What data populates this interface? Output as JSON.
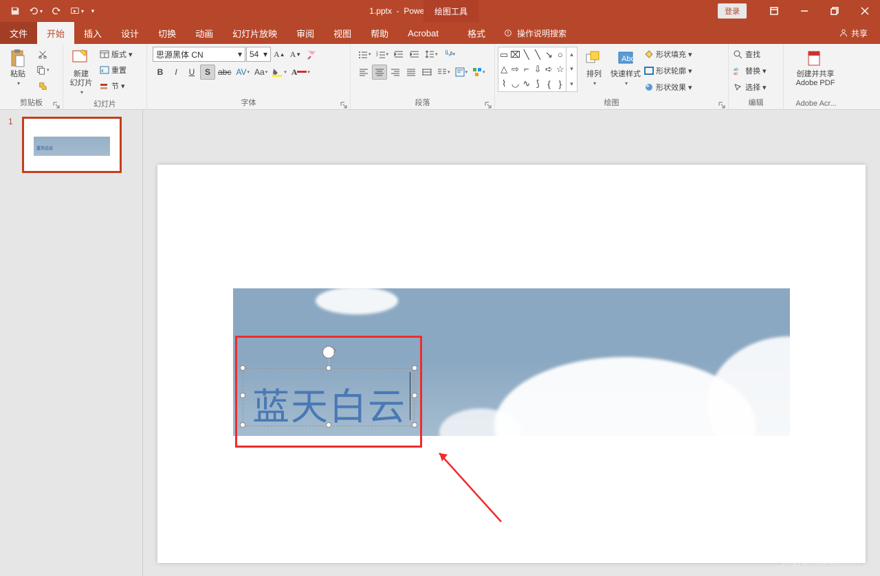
{
  "titlebar": {
    "doc_name": "1.pptx",
    "app_name": "PowerPoint",
    "tools_context": "绘图工具",
    "login": "登录"
  },
  "tabs": {
    "file": "文件",
    "home": "开始",
    "insert": "插入",
    "design": "设计",
    "transitions": "切换",
    "animations": "动画",
    "slideshow": "幻灯片放映",
    "review": "审阅",
    "view": "视图",
    "help": "帮助",
    "acrobat": "Acrobat",
    "format": "格式",
    "tellme": "操作说明搜索",
    "share": "共享"
  },
  "ribbon": {
    "clipboard": {
      "label": "剪贴板",
      "paste": "粘贴"
    },
    "slides": {
      "label": "幻灯片",
      "new_slide": "新建\n幻灯片",
      "layout": "版式",
      "reset": "重置",
      "section": "节"
    },
    "font": {
      "label": "字体",
      "name": "思源黑体 CN",
      "size": "54"
    },
    "paragraph": {
      "label": "段落"
    },
    "drawing": {
      "label": "绘图",
      "arrange": "排列",
      "quick_styles": "快速样式",
      "fill": "形状填充",
      "outline": "形状轮廓",
      "effects": "形状效果"
    },
    "editing": {
      "label": "编辑",
      "find": "查找",
      "replace": "替换",
      "select": "选择"
    },
    "adobe": {
      "label": "Adobe Acr...",
      "create": "创建并共享\nAdobe PDF"
    }
  },
  "slide": {
    "number": "1",
    "text": "蓝天白云"
  },
  "watermark": {
    "brand": "Baidu",
    "sub": "经验",
    "url": "jingyan.baidu.com"
  }
}
